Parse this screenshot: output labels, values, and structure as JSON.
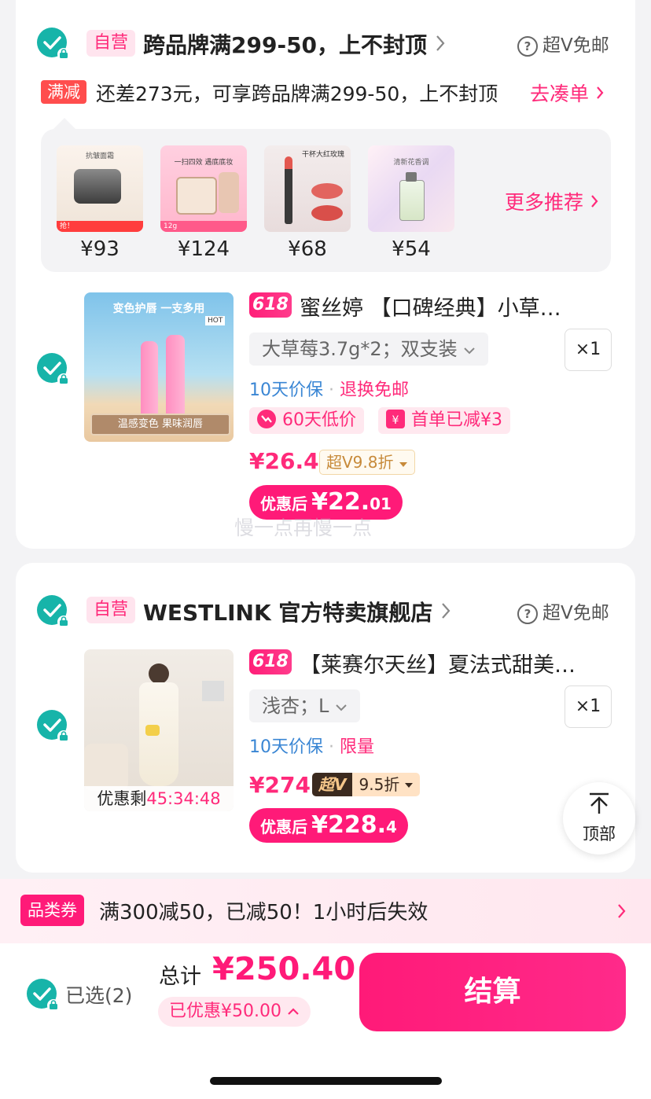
{
  "store1": {
    "tag": "自营",
    "name": "跨品牌满299-50，上不封顶",
    "free_shipping": "超V免邮",
    "manjian_tag": "满减",
    "manjian_text": "还差273元，可享跨品牌满299-50，上不封顶",
    "go_combine": "去凑单",
    "recommend": {
      "more_label": "更多推荐",
      "items": [
        {
          "price": "¥93",
          "thumb_text_top": "抗皱面霜",
          "thumb_text_bottom": "抢！"
        },
        {
          "price": "¥124",
          "thumb_text_top": "一扫四效 遇底底妆",
          "thumb_text_bottom": "12g"
        },
        {
          "price": "¥68",
          "thumb_text_top": "干杯大红玫瑰",
          "thumb_text_bottom": ""
        },
        {
          "price": "¥54",
          "thumb_text_top": "清新花香调",
          "thumb_text_bottom": ""
        }
      ]
    },
    "product": {
      "badge": "618",
      "title": "蜜丝婷 【口碑经典】小草…",
      "sku": "大草莓3.7g*2；双支装",
      "qty": "×1",
      "service1": "10天价保",
      "service2": "退换免邮",
      "promo1": "60天低价",
      "promo2": "首单已减¥3",
      "price": "¥26.4",
      "vtag": "超V9.8折",
      "after_label": "优惠后",
      "after_big": "¥22.",
      "after_small": "01",
      "image_top": "变色护唇  一支多用",
      "image_hot": "HOT",
      "image_bottom": "温感变色 果味润唇",
      "watermark": "慢一点再慢一点"
    }
  },
  "store2": {
    "tag": "自营",
    "name": "WESTLINK 官方特卖旗舰店",
    "free_shipping": "超V免邮",
    "product": {
      "badge": "618",
      "title": "【莱赛尔天丝】夏法式甜美…",
      "sku": "浅杏；L",
      "qty": "×1",
      "service1": "10天价保",
      "service2": "限量",
      "price": "¥274",
      "vtag_dark": "超V",
      "vtag_discount": "9.5折",
      "after_label": "优惠后",
      "after_big": "¥228.",
      "after_small": "4",
      "countdown_label": "优惠剩",
      "countdown": "45:34:48"
    }
  },
  "back_to_top": "顶部",
  "coupon": {
    "tag": "品类券",
    "text": "满300减50，已减50！1小时后失效"
  },
  "footer": {
    "selected": "已选(2)",
    "total_label": "总计",
    "total": "¥250.40",
    "saved": "已优惠¥50.00",
    "checkout": "结算"
  },
  "colors": {
    "accent": "#ff1a78",
    "check": "#17b4a9",
    "link_blue": "#3a86d4"
  }
}
